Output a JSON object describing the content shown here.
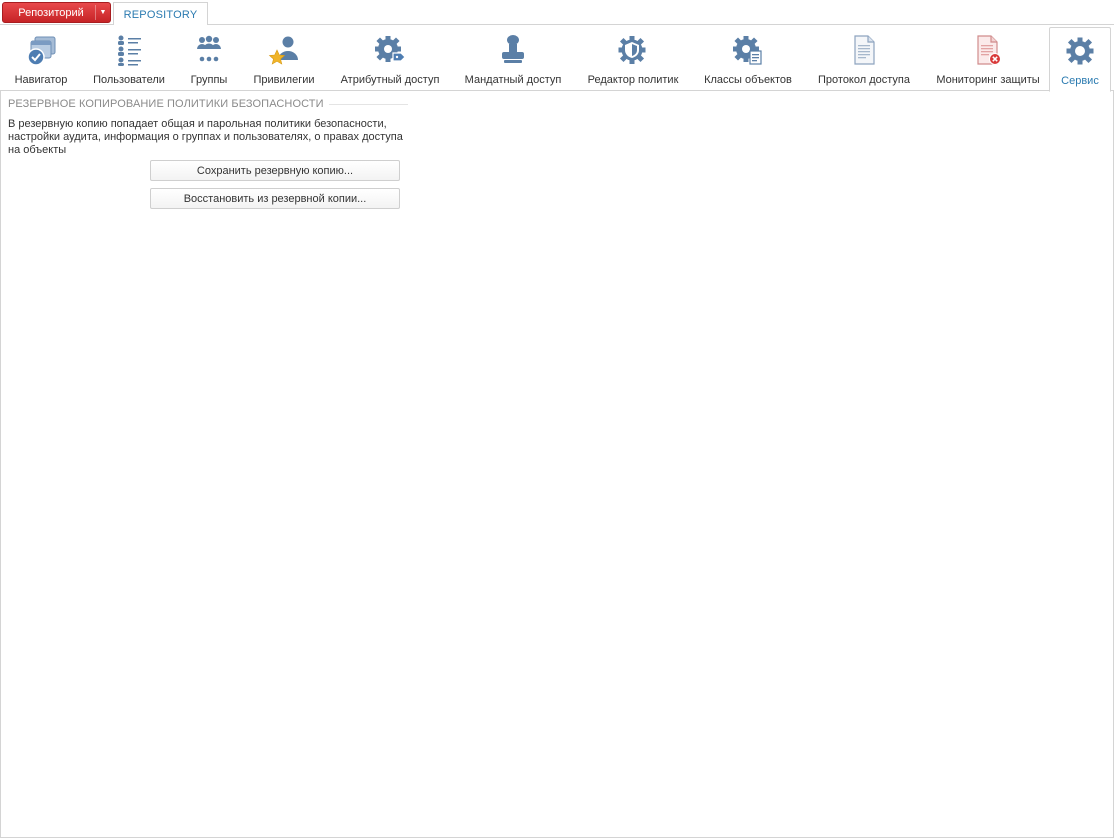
{
  "repo_button": {
    "label": "Репозиторий"
  },
  "repo_tab": {
    "label": "REPOSITORY"
  },
  "ribbon": {
    "items": [
      {
        "label": "Навигатор",
        "icon": "navigator-icon"
      },
      {
        "label": "Пользователи",
        "icon": "users-icon"
      },
      {
        "label": "Группы",
        "icon": "groups-icon"
      },
      {
        "label": "Привилегии",
        "icon": "privileges-icon"
      },
      {
        "label": "Атрибутный доступ",
        "icon": "attribute-access-icon"
      },
      {
        "label": "Мандатный доступ",
        "icon": "mandatory-access-icon"
      },
      {
        "label": "Редактор политик",
        "icon": "policy-editor-icon"
      },
      {
        "label": "Классы объектов",
        "icon": "object-classes-icon"
      },
      {
        "label": "Протокол доступа",
        "icon": "access-log-icon"
      },
      {
        "label": "Мониторинг защиты",
        "icon": "security-monitoring-icon"
      },
      {
        "label": "Сервис",
        "icon": "service-gear-icon",
        "active": true
      }
    ]
  },
  "backup": {
    "title": "РЕЗЕРВНОЕ КОПИРОВАНИЕ ПОЛИТИКИ БЕЗОПАСНОСТИ",
    "description": "В резервную копию попадает общая и парольная политики безопасности, настройки аудита, информация о группах и пользователях, о правах доступа на объекты",
    "save_label": "Сохранить резервную копию...",
    "restore_label": "Восстановить из резервной копии..."
  },
  "colors": {
    "accent": "#2a7ab0",
    "icon_blue": "#5b7fa6",
    "repo_red": "#d4302f",
    "star": "#f0b429",
    "error_red": "#d93a3a"
  }
}
